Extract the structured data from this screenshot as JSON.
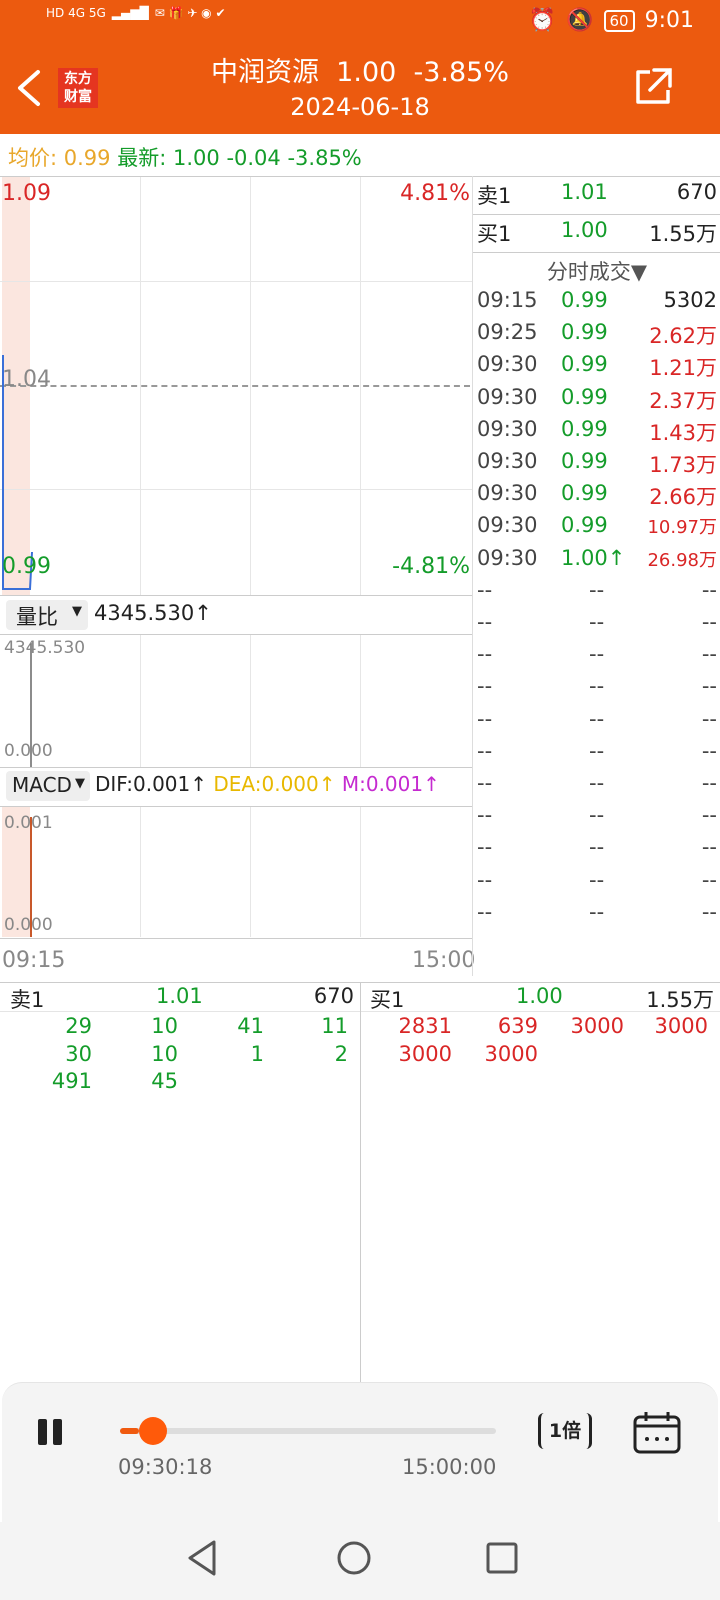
{
  "status_bar": {
    "left_text": "HD 4G 5G",
    "battery": "60",
    "time": "9:01"
  },
  "header": {
    "title": "中润资源  1.00  -3.85%",
    "date": "2024-06-18",
    "logo_line1": "东方",
    "logo_line2": "财富"
  },
  "summary": {
    "avg_label": "均价:",
    "avg_value": "0.99",
    "latest_label": "最新:",
    "latest_value": "1.00",
    "change": "-0.04",
    "change_pct": "-3.85%"
  },
  "price_chart": {
    "top_price": "1.09",
    "top_pct": "4.81%",
    "mid_price": "1.04",
    "bottom_price": "0.99",
    "bottom_pct": "-4.81%"
  },
  "volume_ratio": {
    "selector": "量比",
    "value": "4345.530↑",
    "top": "4345.530",
    "bottom": "0.000"
  },
  "macd": {
    "selector": "MACD",
    "dif": "DIF:0.001↑",
    "dea": "DEA:0.000↑",
    "m": "M:0.001↑",
    "top": "0.001",
    "bottom": "0.000"
  },
  "time_axis": {
    "start": "09:15",
    "end": "15:00"
  },
  "quote": {
    "sell1": {
      "label": "卖1",
      "price": "1.01",
      "volume": "670"
    },
    "buy1": {
      "label": "买1",
      "price": "1.00",
      "volume": "1.55万"
    },
    "trades_title": "分时成交▼",
    "trades": [
      {
        "time": "09:15",
        "price": "0.99",
        "vol": "5302"
      },
      {
        "time": "09:25",
        "price": "0.99",
        "vol": "2.62万"
      },
      {
        "time": "09:30",
        "price": "0.99",
        "vol": "1.21万"
      },
      {
        "time": "09:30",
        "price": "0.99",
        "vol": "2.37万"
      },
      {
        "time": "09:30",
        "price": "0.99",
        "vol": "1.43万"
      },
      {
        "time": "09:30",
        "price": "0.99",
        "vol": "1.73万"
      },
      {
        "time": "09:30",
        "price": "0.99",
        "vol": "2.66万"
      },
      {
        "time": "09:30",
        "price": "0.99",
        "vol": "10.97万"
      },
      {
        "time": "09:30",
        "price": "1.00↑",
        "vol": "26.98万"
      }
    ],
    "empty_cell": "--"
  },
  "queue": {
    "sell_label": "卖1",
    "sell_price": "1.01",
    "sell_vol": "670",
    "buy_label": "买1",
    "buy_price": "1.00",
    "buy_vol": "1.55万",
    "sell_rows": [
      [
        "29",
        "10",
        "41",
        "11"
      ],
      [
        "30",
        "10",
        "1",
        "2"
      ],
      [
        "491",
        "45",
        "",
        ""
      ]
    ],
    "buy_rows": [
      [
        "2831",
        "639",
        "3000",
        "3000"
      ],
      [
        "3000",
        "3000",
        "",
        ""
      ]
    ]
  },
  "player": {
    "current_time": "09:30:18",
    "end_time": "15:00:00",
    "speed": "1倍",
    "progress": 0.03
  }
}
